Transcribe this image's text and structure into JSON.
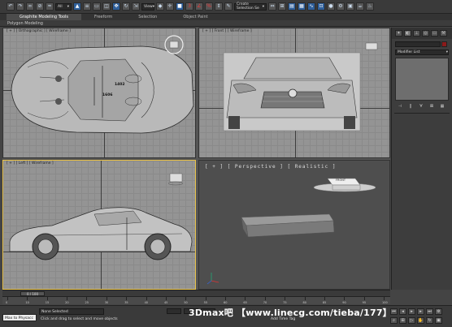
{
  "toolbar": {
    "selection_filter": "All",
    "ref_coord": "View",
    "named_selection": "Create Selection Se",
    "accent_color": "#2f5f9a"
  },
  "ribbon": {
    "tabs": [
      {
        "label": "Graphite Modeling Tools",
        "active": true
      },
      {
        "label": "Freeform",
        "active": false
      },
      {
        "label": "Selection",
        "active": false
      },
      {
        "label": "Object Paint",
        "active": false
      }
    ],
    "sub_label": "Polygon Modeling"
  },
  "viewports": {
    "top": {
      "label": "[ + ] [ Orthographic ] [ Wireframe ]",
      "dim1": "1402",
      "dim2": "1606"
    },
    "front": {
      "label": "[ + ] [ Front ] [ Wireframe ]"
    },
    "left": {
      "label": "[ + ] [ Left ] [ Wireframe ]"
    },
    "perspective": {
      "label": "[ + ] [ Perspective ] [ Realistic ]",
      "viewcube_label": "FRONT"
    },
    "active_border_color": "#e8c24a"
  },
  "command_panel": {
    "modifier_list_label": "Modifier List",
    "color_swatch": "#8b1a1a",
    "tabs": [
      "create-icon",
      "modify-icon",
      "hierarchy-icon",
      "motion-icon",
      "display-icon",
      "utilities-icon"
    ]
  },
  "time_slider": {
    "value": "0 / 100"
  },
  "track_bar": {
    "ticks": [
      "0",
      "10",
      "15",
      "20",
      "25",
      "30",
      "35",
      "40",
      "45",
      "50",
      "55",
      "60",
      "65",
      "70",
      "75",
      "80",
      "85",
      "90",
      "95",
      "100"
    ]
  },
  "status": {
    "maxscript_label": "Max to Physacc",
    "selection_status": "None Selected",
    "prompt": "Click and drag to select and move objects",
    "add_time_tag": "Add Time Tag",
    "watermark": "3Dmax吧 【www.linecg.com/tieba/177】"
  }
}
